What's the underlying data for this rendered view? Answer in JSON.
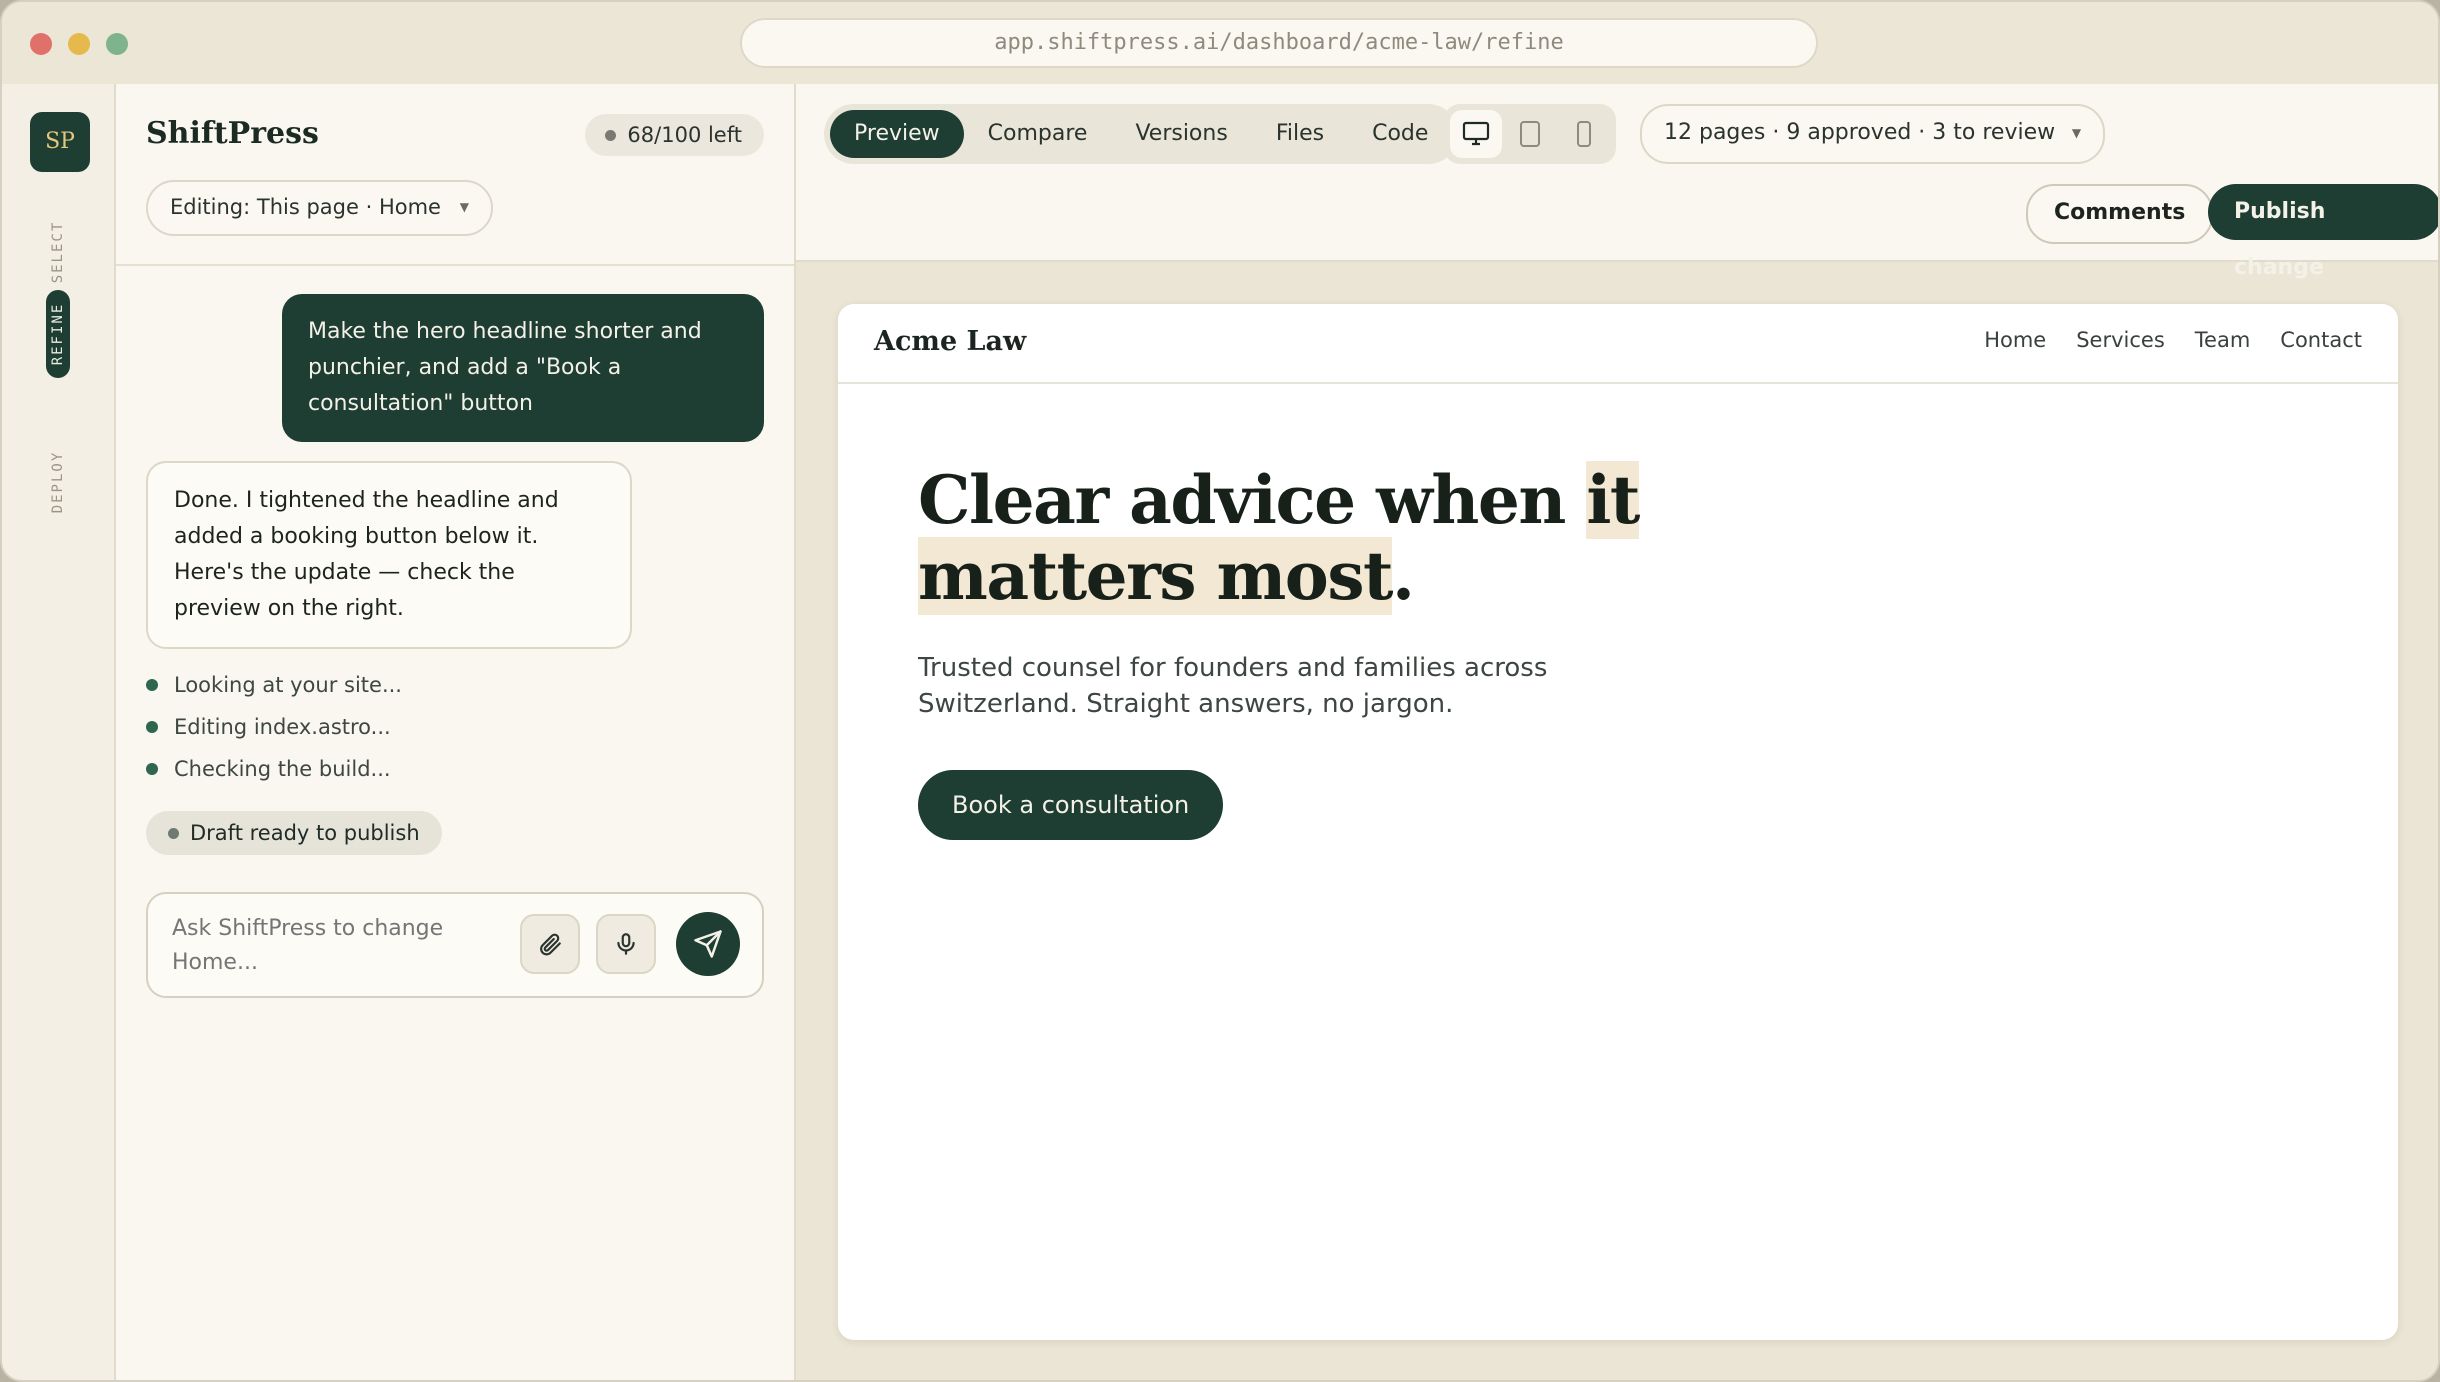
{
  "browser": {
    "url": "app.shiftpress.ai/dashboard/acme-law/refine"
  },
  "rail": {
    "logo": "SP",
    "items": [
      "SELECT",
      "REFINE",
      "DEPLOY"
    ],
    "active": "REFINE"
  },
  "chat": {
    "app_name": "ShiftPress",
    "credits": "68/100 left",
    "editing_scope": "Editing: This page · Home",
    "user_message": "Make the hero headline shorter and punchier, and add a \"Book a consultation\" button",
    "assistant_message": "Done. I tightened the headline and added a booking button below it. Here's the update — check the preview on the right.",
    "steps": [
      "Looking at your site...",
      "Editing index.astro...",
      "Checking the build..."
    ],
    "draft_status": "Draft ready to publish",
    "composer_placeholder": "Ask ShiftPress to change Home..."
  },
  "toolbar": {
    "tabs": [
      "Preview",
      "Compare",
      "Versions",
      "Files",
      "Code"
    ],
    "active_tab": "Preview",
    "devices": [
      "desktop-icon",
      "tablet-icon",
      "phone-icon"
    ],
    "active_device": "desktop",
    "pages_summary": "12 pages · 9 approved · 3 to review",
    "comments_label": "Comments",
    "publish_label": "Publish change"
  },
  "preview": {
    "brand": "Acme Law",
    "nav": [
      "Home",
      "Services",
      "Team",
      "Contact"
    ],
    "headline_part1": "Clear advice when ",
    "headline_hl1": "it",
    "headline_hl2": "matters most",
    "headline_end": ".",
    "subheadline": "Trusted counsel for founders and families across Switzerland. Straight answers, no jargon.",
    "cta": "Book a consultation"
  },
  "colors": {
    "brand_green": "#1e3d33",
    "highlight": "#f3e8d3",
    "panel_bg": "#faf7f0",
    "canvas_bg": "#ebe5d6"
  }
}
